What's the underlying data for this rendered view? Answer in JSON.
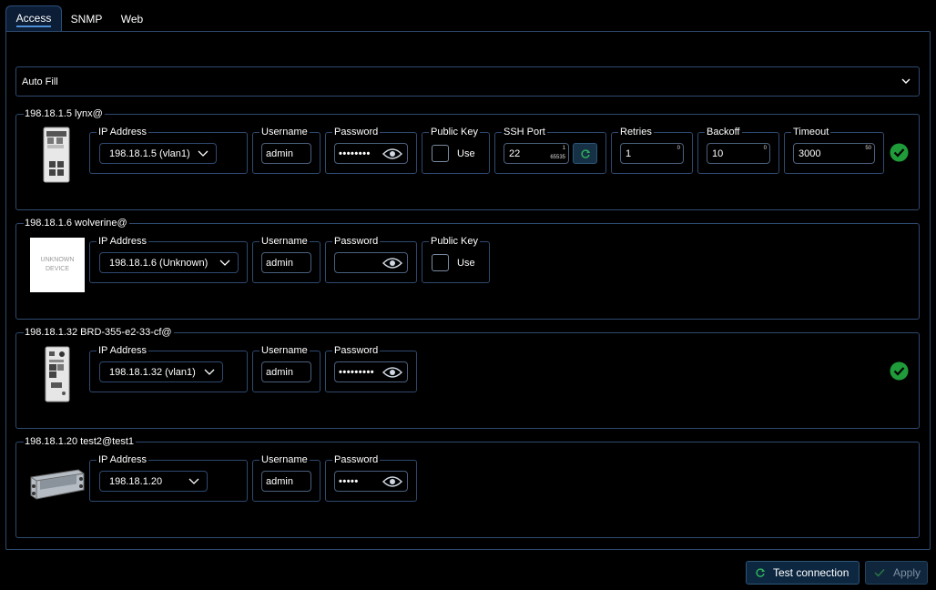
{
  "tabs": [
    {
      "label": "Access",
      "active": true
    },
    {
      "label": "SNMP",
      "active": false
    },
    {
      "label": "Web",
      "active": false
    }
  ],
  "autofill": {
    "label": "Auto Fill"
  },
  "labels": {
    "ip_address": "IP Address",
    "username": "Username",
    "password": "Password",
    "public_key": "Public Key",
    "use": "Use",
    "ssh_port": "SSH Port",
    "retries": "Retries",
    "backoff": "Backoff",
    "timeout": "Timeout"
  },
  "devices": [
    {
      "title": "198.18.1.5 lynx@",
      "ip_select": "198.18.1.5 (vlan1)",
      "username": "admin",
      "password_mask": "••••••••",
      "public_key_used": false,
      "ssh_port": {
        "value": "22",
        "max_hint": "1",
        "min_hint": "65535"
      },
      "retries": {
        "value": "1",
        "hint": "0"
      },
      "backoff": {
        "value": "10",
        "hint": "0"
      },
      "timeout": {
        "value": "3000",
        "hint": "50"
      },
      "connected": true
    },
    {
      "title": "198.18.1.6 wolverine@",
      "ip_select": "198.18.1.6 (Unknown)",
      "username": "admin",
      "password_mask": "",
      "public_key_used": false,
      "image_text": "UNKNOWN DEVICE",
      "connected": false
    },
    {
      "title": "198.18.1.32 BRD-355-e2-33-cf@",
      "ip_select": "198.18.1.32 (vlan1)",
      "username": "admin",
      "password_mask": "•••••••••",
      "connected": true
    },
    {
      "title": "198.18.1.20 test2@test1",
      "ip_select": "198.18.1.20",
      "username": "admin",
      "password_mask": "•••••",
      "connected": false
    }
  ],
  "actions": {
    "test_connection": "Test connection",
    "apply": "Apply"
  },
  "colors": {
    "border": "#2e4a70",
    "success": "#1f9b3a",
    "tab_active_bg": "#0c1e36",
    "button_bg": "#0d2740"
  }
}
